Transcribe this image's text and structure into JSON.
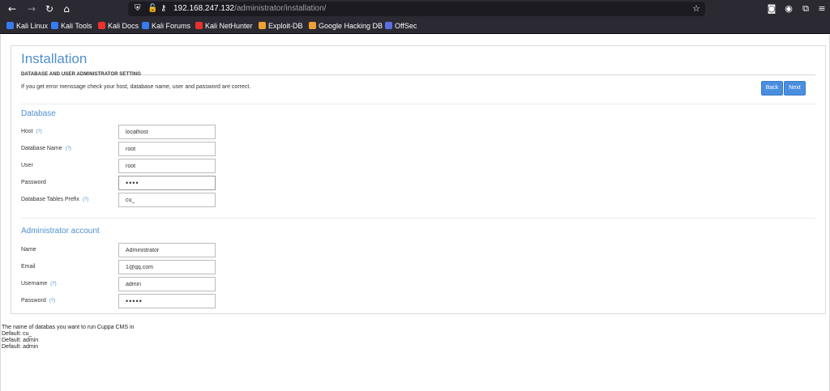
{
  "browser": {
    "url_host": "192.168.247.132",
    "url_path": "/administrator/installation/",
    "bookmarks": [
      {
        "label": "Kali Linux",
        "color": "#367bf0"
      },
      {
        "label": "Kali Tools",
        "color": "#367bf0"
      },
      {
        "label": "Kali Docs",
        "color": "#e8322f"
      },
      {
        "label": "Kali Forums",
        "color": "#367bf0"
      },
      {
        "label": "Kali NetHunter",
        "color": "#e8322f"
      },
      {
        "label": "Exploit-DB",
        "color": "#f0a030"
      },
      {
        "label": "Google Hacking DB",
        "color": "#f0a030"
      },
      {
        "label": "OffSec",
        "color": "#5b6ee1"
      }
    ]
  },
  "page": {
    "title": "Installation",
    "subhead": "DATABASE AND USER ADMINISTRATOR SETTING",
    "hint": "If you get error menssage check your host, database name, user and password are correct.",
    "buttons": {
      "back": "Back",
      "next": "Next"
    },
    "database": {
      "heading": "Database",
      "fields": [
        {
          "label": "Host",
          "help": "(?)",
          "value": "localhost"
        },
        {
          "label": "Database Name",
          "help": "(?)",
          "value": "root"
        },
        {
          "label": "User",
          "help": "",
          "value": "root"
        },
        {
          "label": "Password",
          "help": "",
          "value": "••••"
        },
        {
          "label": "Database Tables Prefix",
          "help": "(?)",
          "value": "cu_"
        }
      ]
    },
    "admin": {
      "heading": "Administrator account",
      "fields": [
        {
          "label": "Name",
          "help": "",
          "value": "Administrator"
        },
        {
          "label": "Email",
          "help": "",
          "value": "1@qq.com"
        },
        {
          "label": "Username",
          "help": "(?)",
          "value": "admin"
        },
        {
          "label": "Password",
          "help": "(?)",
          "value": "•••••"
        }
      ]
    },
    "help_text": [
      "The name of databas you want to run Cuppa CMS in",
      "Default: cu_",
      "Default: admin",
      "Default: admin"
    ]
  }
}
